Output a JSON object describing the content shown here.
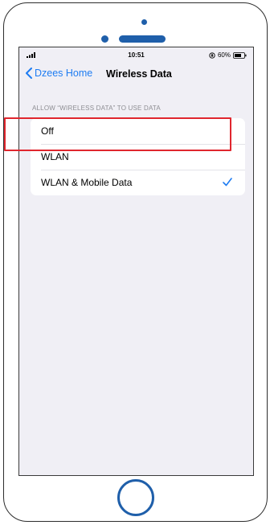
{
  "status_bar": {
    "time": "10:51",
    "battery": "60%",
    "icons": [
      "signal-icon",
      "rotation-lock-icon",
      "battery-icon"
    ]
  },
  "nav": {
    "back_label": "Dzees Home",
    "title": "Wireless Data"
  },
  "section": {
    "header": "ALLOW “WIRELESS DATA” TO USE DATA",
    "options": [
      {
        "label": "Off",
        "selected": false
      },
      {
        "label": "WLAN",
        "selected": false
      },
      {
        "label": "WLAN & Mobile Data",
        "selected": true
      }
    ]
  },
  "colors": {
    "accent": "#1e7cf2",
    "highlight": "#e0262e",
    "device_blue": "#1f5faa"
  }
}
